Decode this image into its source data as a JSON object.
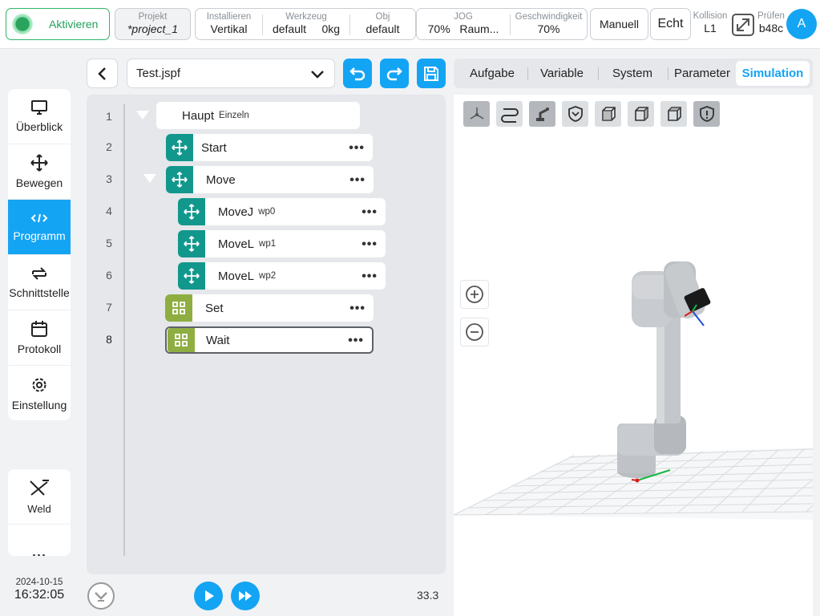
{
  "topbar": {
    "activate_label": "Aktivieren",
    "project": {
      "label": "Projekt",
      "value": "*project_1"
    },
    "install": {
      "label": "Installieren",
      "value": "Vertikal"
    },
    "tool": {
      "label": "Werkzeug",
      "value1": "default",
      "value2": "0kg"
    },
    "obj": {
      "label": "Obj",
      "value": "default"
    },
    "jog": {
      "label": "JOG",
      "value1": "70%",
      "value2": "Raum..."
    },
    "speed": {
      "label": "Geschwindigkeit",
      "value": "70%"
    },
    "mode_manual": "Manuell",
    "mode_real": "Echt",
    "collision": {
      "label": "Kollision",
      "value": "L1"
    },
    "check": {
      "label": "Prüfen",
      "value": "b48c"
    },
    "avatar": "A"
  },
  "nav": {
    "items": [
      {
        "label": "Überblick",
        "icon": "monitor-icon"
      },
      {
        "label": "Bewegen",
        "icon": "move-icon"
      },
      {
        "label": "Programm",
        "icon": "code-icon"
      },
      {
        "label": "Schnittstelle",
        "icon": "swap-icon"
      },
      {
        "label": "Protokoll",
        "icon": "calendar-icon"
      },
      {
        "label": "Einstellung",
        "icon": "gear-icon"
      }
    ],
    "extra": [
      {
        "label": "Weld",
        "icon": "weld-icon"
      },
      {
        "label": "..."
      }
    ]
  },
  "datetime": {
    "date": "2024-10-15",
    "time": "16:32:05"
  },
  "program": {
    "file": "Test.jspf",
    "lines": [
      "1",
      "2",
      "3",
      "4",
      "5",
      "6",
      "7",
      "8"
    ],
    "nodes": [
      {
        "name": "Haupt",
        "sub": "Einzeln"
      },
      {
        "name": "Start",
        "sub": ""
      },
      {
        "name": "Move",
        "sub": ""
      },
      {
        "name": "MoveJ",
        "sub": "wp0"
      },
      {
        "name": "MoveL",
        "sub": "wp1"
      },
      {
        "name": "MoveL",
        "sub": "wp2"
      },
      {
        "name": "Set",
        "sub": ""
      },
      {
        "name": "Wait",
        "sub": ""
      }
    ],
    "speed_value": "33.3"
  },
  "tabs": [
    "Aufgabe",
    "Variable",
    "System",
    "Parameter",
    "Simulation"
  ],
  "colors": {
    "accent": "#14a4f4",
    "teal": "#12978c",
    "green": "#8fae42",
    "active_green": "#2fb56a"
  }
}
